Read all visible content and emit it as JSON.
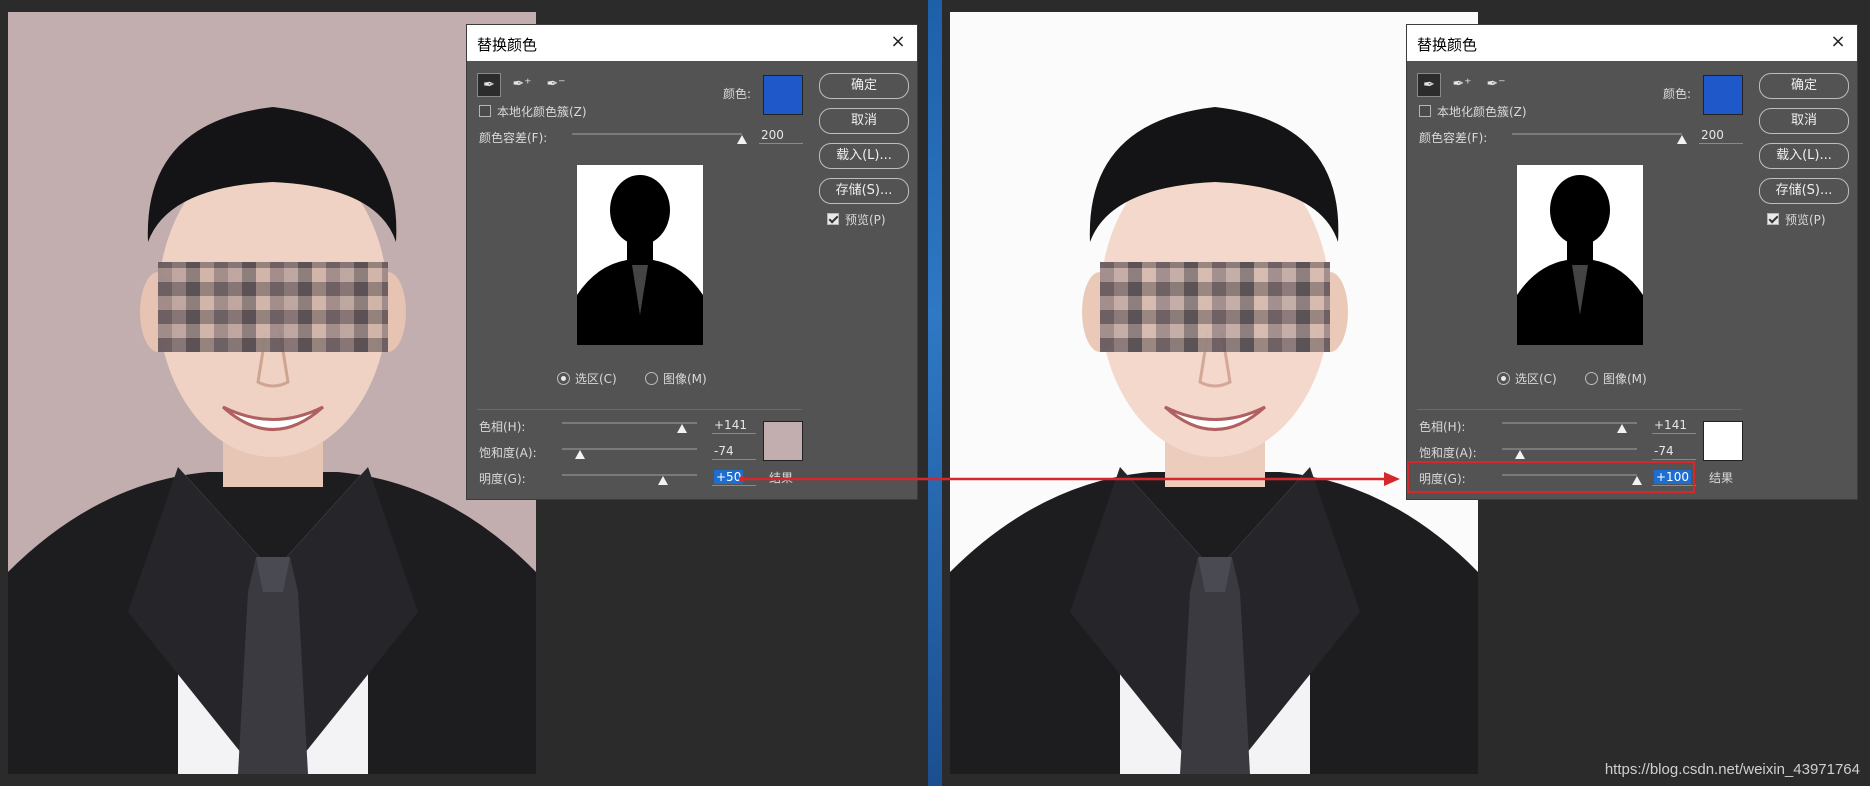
{
  "colors": {
    "accent_blue": "#1f58c8",
    "result_left": "#c3aeaf",
    "result_right": "#ffffff",
    "bg_left": "#c3aeaf",
    "bg_right": "#fbfbfb",
    "highlight": "#d4282c"
  },
  "dialog_left": {
    "title": "替换颜色",
    "close_icon": "×",
    "color_label": "颜色:",
    "localize_label": "本地化颜色簇(Z)",
    "tolerance_label": "颜色容差(F):",
    "tolerance_value": "200",
    "tolerance_level": 1.0,
    "ok": "确定",
    "cancel": "取消",
    "load": "载入(L)...",
    "save": "存储(S)...",
    "preview_label": "预览(P)",
    "radio_selection": "选区(C)",
    "radio_image": "图像(M)",
    "hue_label": "色相(H):",
    "hue_value": "+141",
    "hue_level": 0.89,
    "sat_label": "饱和度(A):",
    "sat_value": "-74",
    "sat_level": 0.13,
    "light_label": "明度(G):",
    "light_value": "+50",
    "light_level": 0.75,
    "result_label": "结果"
  },
  "dialog_right": {
    "title": "替换颜色",
    "close_icon": "×",
    "color_label": "颜色:",
    "localize_label": "本地化颜色簇(Z)",
    "tolerance_label": "颜色容差(F):",
    "tolerance_value": "200",
    "tolerance_level": 1.0,
    "ok": "确定",
    "cancel": "取消",
    "load": "载入(L)...",
    "save": "存储(S)...",
    "preview_label": "预览(P)",
    "radio_selection": "选区(C)",
    "radio_image": "图像(M)",
    "hue_label": "色相(H):",
    "hue_value": "+141",
    "hue_level": 0.89,
    "sat_label": "饱和度(A):",
    "sat_value": "-74",
    "sat_level": 0.13,
    "light_label": "明度(G):",
    "light_value": "+100",
    "light_level": 1.0,
    "result_label": "结果"
  },
  "icons": {
    "eyedropper": "eyedropper-icon",
    "eyedropper_plus": "eyedropper-plus-icon",
    "eyedropper_minus": "eyedropper-minus-icon"
  },
  "watermark": "https://blog.csdn.net/weixin_43971764"
}
